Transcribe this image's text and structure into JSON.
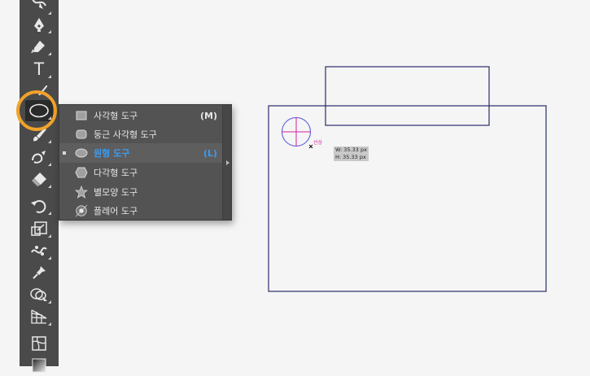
{
  "tools": [
    {
      "name": "curvature-tool",
      "icon": "curvature-pen-icon"
    },
    {
      "name": "pen-tool",
      "icon": "pen-icon"
    },
    {
      "name": "pencil-tool",
      "icon": "pencil-curve-icon"
    },
    {
      "name": "type-tool",
      "icon": "type-icon",
      "glyph": "T"
    },
    {
      "name": "line-tool",
      "icon": "line-segment-icon"
    },
    {
      "name": "ellipse-tool",
      "icon": "ellipse-icon"
    },
    {
      "name": "paintbrush-tool",
      "icon": "paintbrush-icon"
    },
    {
      "name": "shaper-tool",
      "icon": "shaper-icon"
    },
    {
      "name": "eraser-tool",
      "icon": "eraser-icon"
    },
    {
      "name": "rotate-tool",
      "icon": "rotate-icon"
    },
    {
      "name": "scale-tool",
      "icon": "scale-icon"
    },
    {
      "name": "puppet-warp-tool",
      "icon": "puppet-warp-icon"
    },
    {
      "name": "pin-tool",
      "icon": "pin-icon"
    },
    {
      "name": "shape-builder-tool",
      "icon": "shape-builder-icon"
    },
    {
      "name": "perspective-grid-tool",
      "icon": "perspective-grid-icon"
    },
    {
      "name": "mesh-tool",
      "icon": "mesh-icon"
    },
    {
      "name": "gradient-tool",
      "icon": "gradient-icon"
    }
  ],
  "flyout": {
    "items": [
      {
        "label": "사각형 도구",
        "shortcut": "(M)",
        "icon": "rectangle-icon",
        "selected": false
      },
      {
        "label": "둥근 사각형 도구",
        "shortcut": "",
        "icon": "rounded-rectangle-icon",
        "selected": false
      },
      {
        "label": "원형 도구",
        "shortcut": "(L)",
        "icon": "ellipse-icon",
        "selected": true
      },
      {
        "label": "다각형 도구",
        "shortcut": "",
        "icon": "polygon-icon",
        "selected": false
      },
      {
        "label": "별모양 도구",
        "shortcut": "",
        "icon": "star-icon",
        "selected": false
      },
      {
        "label": "플레어 도구",
        "shortcut": "",
        "icon": "flare-icon",
        "selected": false
      }
    ]
  },
  "canvas": {
    "smart_guide_label": "선상",
    "tooltip_width": "W: 35.33 px",
    "tooltip_height": "H: 35.33 px"
  },
  "colors": {
    "toolbar_bg": "#4a4a4a",
    "highlight_ring": "#f0a22a",
    "selected_text": "#3b9bf0",
    "artwork_stroke": "#2b2a6b",
    "ellipse_stroke": "#6b6bd9",
    "guide_magenta": "#d3239f"
  }
}
